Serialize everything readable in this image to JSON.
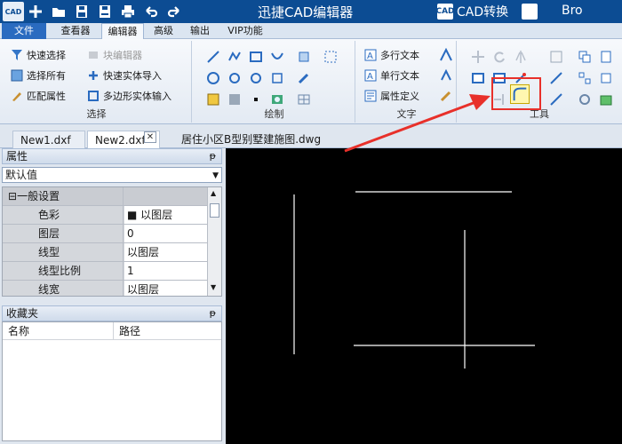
{
  "titlebar": {
    "app_logo": "CAD",
    "title": "迅捷CAD编辑器",
    "convert_label": "CAD转换",
    "convert_icon": "CAD",
    "user": "Bro",
    "quick_access_icons": [
      "new-icon",
      "open-icon",
      "save-icon",
      "save-as-icon",
      "print-icon",
      "undo-icon",
      "redo-icon"
    ]
  },
  "menu": {
    "tabs": [
      "文件",
      "查看器",
      "编辑器",
      "高级",
      "输出",
      "VIP功能"
    ],
    "active": "编辑器"
  },
  "ribbon": {
    "select_group": {
      "label": "选择",
      "items": [
        "快速选择",
        "选择所有",
        "匹配属性",
        "块编辑器",
        "快速实体导入",
        "多边形实体输入"
      ]
    },
    "draw_group": {
      "label": "绘制"
    },
    "text_group": {
      "label": "文字",
      "items": [
        "多行文本",
        "单行文本",
        "属性定义"
      ]
    },
    "tools_group": {
      "label": "工具"
    }
  },
  "doc_tabs": [
    "New1.dxf",
    "New2.dxf",
    "居住小区B型别墅建施图.dwg"
  ],
  "tab_close": "✕",
  "properties": {
    "title": "属性",
    "pin": "ᵽ",
    "selector": "默认值",
    "category": "一般设置",
    "category_toggle": "⊟",
    "rows": [
      {
        "key": "色彩",
        "value": "■ 以图层"
      },
      {
        "key": "图层",
        "value": "0"
      },
      {
        "key": "线型",
        "value": "以图层"
      },
      {
        "key": "线型比例",
        "value": "1"
      },
      {
        "key": "线宽",
        "value": "以图层"
      }
    ]
  },
  "favorites": {
    "title": "收藏夹",
    "columns": [
      "名称",
      "路径"
    ]
  },
  "colors": {
    "titlebar": "#0c4c93",
    "highlight": "#e8302a",
    "canvas": "#000000"
  }
}
